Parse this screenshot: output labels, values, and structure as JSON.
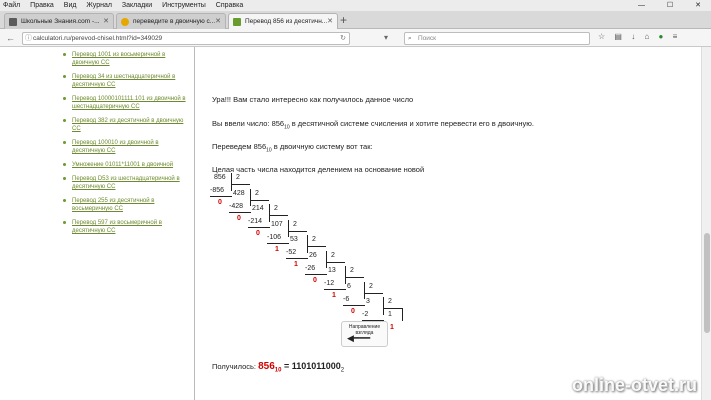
{
  "menu": [
    "Файл",
    "Правка",
    "Вид",
    "Журнал",
    "Закладки",
    "Инструменты",
    "Справка"
  ],
  "window_controls": [
    "—",
    "☐",
    "✕"
  ],
  "tabs": [
    {
      "label": "Школьные Знания.com -...",
      "color": "#5b5b5b",
      "active": false
    },
    {
      "label": "переведите в двоичную с...",
      "color": "#e6a700",
      "active": false
    },
    {
      "label": "Перевод 856 из десятичн...",
      "color": "#6a9b2e",
      "active": true
    }
  ],
  "url": "calculatori.ru/perevod-chisel.html?id=349029",
  "search_placeholder": "Поиск",
  "sidebar_links": [
    "Перевод 1001 из восьмеричной в двоичную СС",
    "Перевод 34 из шестнадцатеричной в десятичную СС",
    "Перевод 10000101111.101 из двоичной в шестнадцатеричную СС",
    "Перевод 382 из десятичной в двоичную СС",
    "Перевод 100010 из двоичной в десятичную СС",
    "Умножение 01011*11001 в двоичной",
    "Перевод D53 из шестнадцатеричной в десятичную СС",
    "Перевод 255 из десятичной в восьмеричную СС",
    "Перевод 597 из восьмеричной в десятичную СС"
  ],
  "main": {
    "intro": "Ура!!! Вам стало интересно как получилось данное число",
    "entered_pre": "Вы ввели число: 856",
    "entered_sub": "10",
    "entered_post": " в десятичной системе счисления и хотите перевести его в двоичную.",
    "translate_pre": "Переведем 856",
    "translate_sub": "10",
    "translate_post": " в двоичную систему вот так:",
    "integer_note": "Целая часть числа находится делением на основание новой",
    "direction_label": "Направление",
    "direction_label2": "взгляда",
    "result_label": "Получилось: ",
    "result_num": "856",
    "result_base": "10",
    "result_eq": " = 1101011000",
    "result_base2": "2"
  },
  "division": {
    "dividends": [
      "856",
      "428",
      "214",
      "107",
      "53",
      "26",
      "13",
      "6",
      "3"
    ],
    "divisors": [
      "2",
      "2",
      "2",
      "2",
      "2",
      "2",
      "2",
      "2",
      "2"
    ],
    "subtracts": [
      "-856",
      "-428",
      "-214",
      "-106",
      "-52",
      "-26",
      "-12",
      "-6",
      "-2"
    ],
    "remainders": [
      "0",
      "0",
      "0",
      "1",
      "1",
      "0",
      "1",
      "0",
      "1"
    ],
    "last_quotient": "1",
    "final_bit": "1"
  },
  "watermark": "online-otvet.ru"
}
